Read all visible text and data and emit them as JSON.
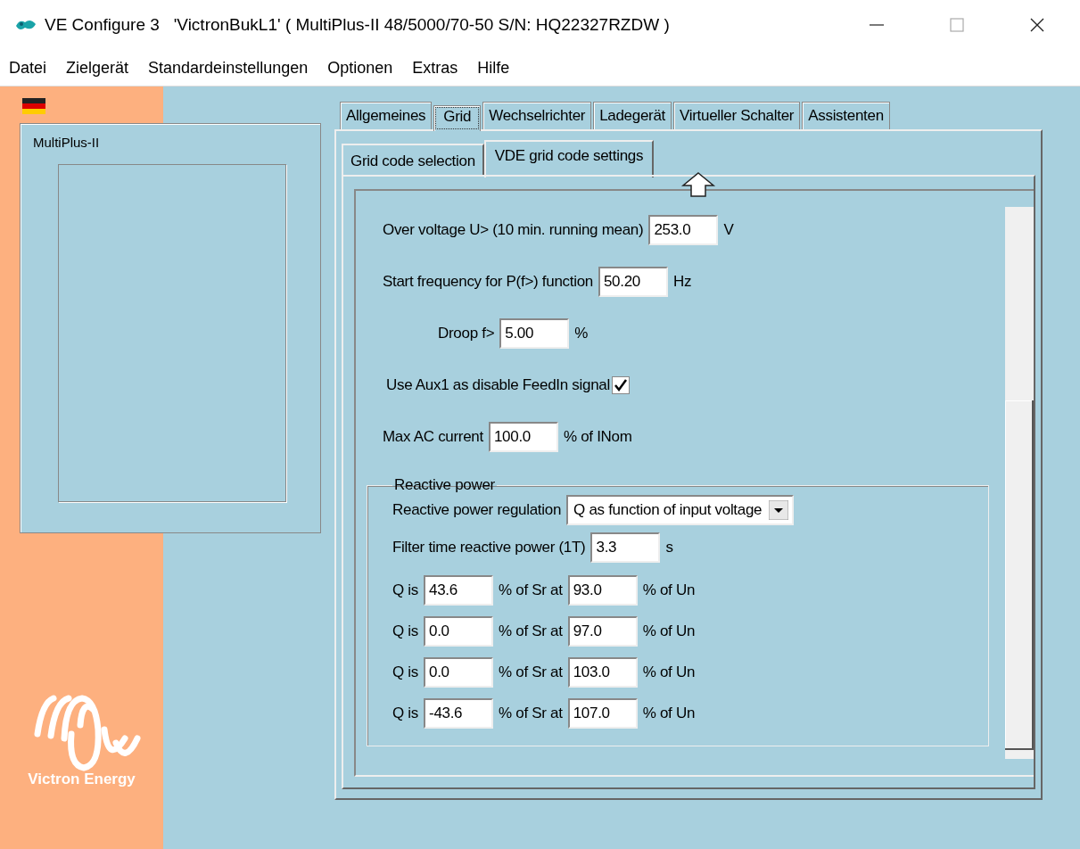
{
  "window": {
    "title": "VE Configure 3   'VictronBukL1' ( MultiPlus-II 48/5000/70-50 S/N: HQ22327RZDW )"
  },
  "menu": [
    "Datei",
    "Zielgerät",
    "Standardeinstellungen",
    "Optionen",
    "Extras",
    "Hilfe"
  ],
  "device_panel": {
    "title": "MultiPlus-II"
  },
  "logo": {
    "text": "Victron Energy"
  },
  "tabs": [
    {
      "label": "Allgemeines",
      "selected": false
    },
    {
      "label": "Grid",
      "selected": true
    },
    {
      "label": "Wechselrichter",
      "selected": false
    },
    {
      "label": "Ladegerät",
      "selected": false
    },
    {
      "label": "Virtueller Schalter",
      "selected": false
    },
    {
      "label": "Assistenten",
      "selected": false
    }
  ],
  "subtabs": [
    {
      "label": "Grid code selection",
      "selected": false
    },
    {
      "label": "VDE grid code settings",
      "selected": true
    }
  ],
  "settings": [
    {
      "kind": "field",
      "label": "Over voltage U> (10 min. running mean)",
      "value": "253.0",
      "unit": "V"
    },
    {
      "kind": "field",
      "label": "Start frequency for P(f>) function",
      "value": "50.20",
      "unit": "Hz"
    },
    {
      "kind": "subfield",
      "label": "Droop f>",
      "value": "5.00",
      "unit": "%"
    },
    {
      "kind": "checkbox",
      "label": "Use Aux1 as disable FeedIn signal",
      "checked": true
    },
    {
      "kind": "field",
      "label": "Max AC current",
      "value": "100.0",
      "unit": "% of INom"
    }
  ],
  "reactive_power": {
    "title": "Reactive power",
    "regulation": {
      "label": "Reactive power regulation",
      "value": "Q as function of input voltage"
    },
    "filter": {
      "label": "Filter time reactive power (1T)",
      "value": "3.3",
      "unit": "s"
    },
    "points": [
      {
        "prefix": "Q is",
        "q": "43.6",
        "middle": "% of Sr at",
        "u": "93.0",
        "unit": "% of Un"
      },
      {
        "prefix": "Q is",
        "q": "0.0",
        "middle": "% of Sr at",
        "u": "97.0",
        "unit": "% of Un"
      },
      {
        "prefix": "Q is",
        "q": "0.0",
        "middle": "% of Sr at",
        "u": "103.0",
        "unit": "% of Un"
      },
      {
        "prefix": "Q is",
        "q": "-43.6",
        "middle": "% of Sr at",
        "u": "107.0",
        "unit": "% of Un"
      }
    ]
  }
}
